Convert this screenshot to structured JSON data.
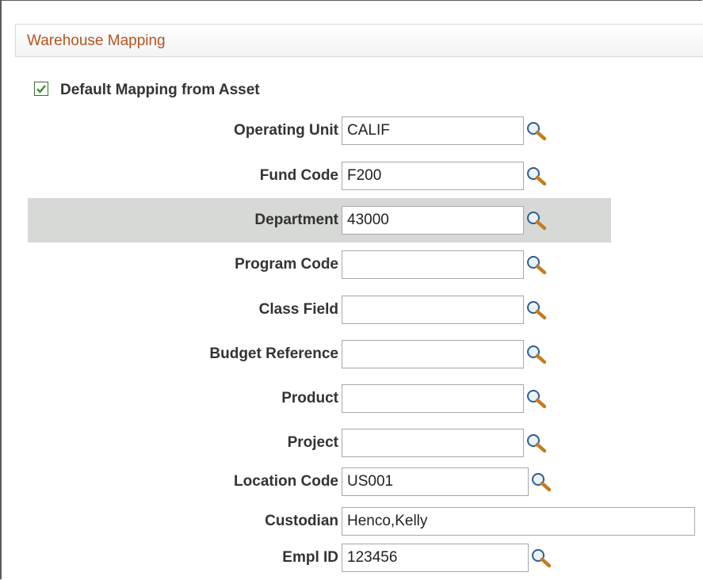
{
  "section": {
    "title": "Warehouse Mapping"
  },
  "default_mapping": {
    "label": "Default Mapping from Asset",
    "checked": true
  },
  "fields": {
    "operating_unit": {
      "label": "Operating Unit",
      "value": "CALIF"
    },
    "fund_code": {
      "label": "Fund Code",
      "value": "F200"
    },
    "department": {
      "label": "Department",
      "value": "43000"
    },
    "program_code": {
      "label": "Program Code",
      "value": ""
    },
    "class_field": {
      "label": "Class Field",
      "value": ""
    },
    "budget_reference": {
      "label": "Budget Reference",
      "value": ""
    },
    "product": {
      "label": "Product",
      "value": ""
    },
    "project": {
      "label": "Project",
      "value": ""
    },
    "location_code": {
      "label": "Location Code",
      "value": "US001"
    },
    "custodian": {
      "label": "Custodian",
      "value": "Henco,Kelly"
    },
    "empl_id": {
      "label": "Empl ID",
      "value": "123456"
    }
  },
  "icons": {
    "lookup": "magnifier-lookup-icon",
    "check": "checkmark-icon"
  },
  "colors": {
    "section_title": "#b5541f",
    "highlight_row": "#d7d9d6",
    "checkbox_check": "#3d8a2a"
  }
}
